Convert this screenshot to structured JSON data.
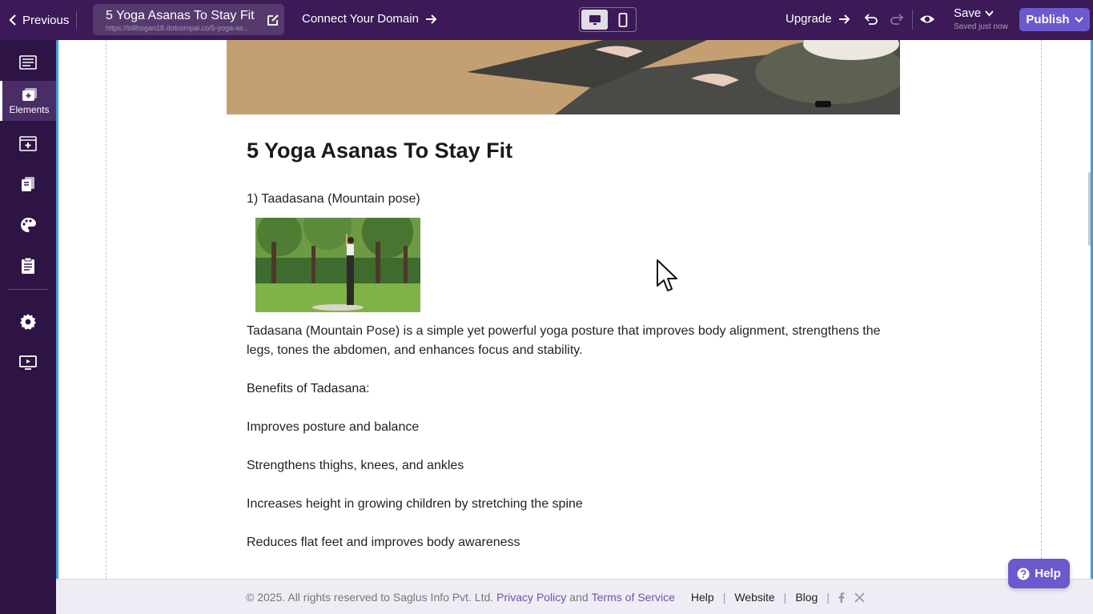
{
  "topbar": {
    "previous_label": "Previous",
    "page_title": "5 Yoga Asanas To Stay Fit",
    "page_url": "https://billhogan18.dotcompal.co/5-yoga-as...",
    "connect_domain_label": "Connect Your Domain",
    "upgrade_label": "Upgrade",
    "save_label": "Save",
    "save_status": "Saved just now",
    "publish_label": "Publish"
  },
  "sidebar": {
    "items": [
      {
        "icon": "pages-icon",
        "label": ""
      },
      {
        "icon": "elements-icon",
        "label": "Elements"
      },
      {
        "icon": "sections-icon",
        "label": ""
      },
      {
        "icon": "library-icon",
        "label": ""
      },
      {
        "icon": "palette-icon",
        "label": ""
      },
      {
        "icon": "forms-icon",
        "label": ""
      },
      {
        "icon": "settings-icon",
        "label": ""
      },
      {
        "icon": "presentation-icon",
        "label": ""
      }
    ]
  },
  "article": {
    "title": "5 Yoga Asanas To Stay Fit",
    "pose_heading": "1) Taadasana (Mountain pose)",
    "intro_line1": "Tadasana (Mountain Pose) is a simple yet powerful yoga posture that improves body alignment, strengthens the",
    "intro_line2": "legs, tones the abdomen, and enhances focus and stability.",
    "benefits_heading": "Benefits of Tadasana:",
    "benefits": [
      "Improves posture and balance",
      "Strengthens thighs, knees, and ankles",
      "Increases height in growing children by stretching the spine",
      "Reduces flat feet and improves body awareness"
    ]
  },
  "footer": {
    "copyright": "©  2025. All rights reserved to Saglus Info Pvt. Ltd.",
    "privacy_link": "Privacy Policy",
    "and_text": "and",
    "terms_link": "Terms of Service",
    "help_link": "Help",
    "website_link": "Website",
    "blog_link": "Blog",
    "separator": "|"
  },
  "help_button_label": "Help",
  "colors": {
    "topbar_bg": "#3b1a57",
    "sidebar_bg": "#2e1345",
    "accent": "#6a5acd",
    "canvas_border": "#3da0e0"
  }
}
